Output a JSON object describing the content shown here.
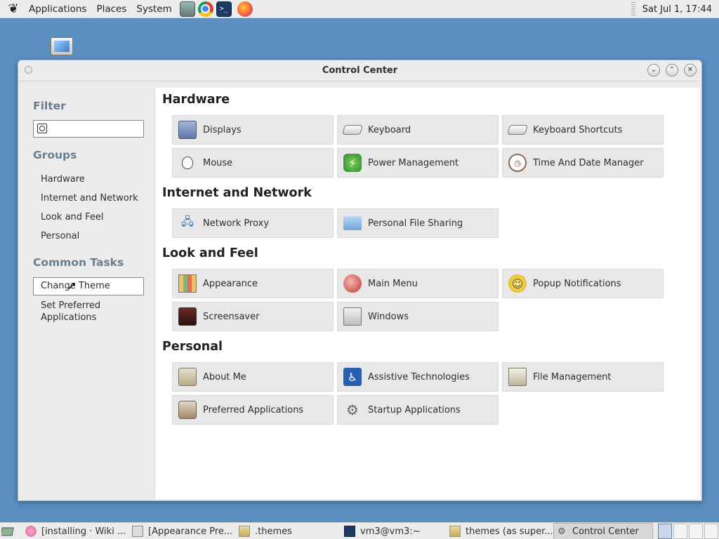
{
  "top_panel": {
    "menus": [
      "Applications",
      "Places",
      "System"
    ],
    "clock": "Sat Jul 1, 17:44"
  },
  "window": {
    "title": "Control Center",
    "buttons": {
      "minimize": "⌄",
      "maximize": "⌃",
      "close": "✕"
    }
  },
  "sidebar": {
    "filter_heading": "Filter",
    "filter_placeholder": "",
    "groups_heading": "Groups",
    "groups": [
      "Hardware",
      "Internet and Network",
      "Look and Feel",
      "Personal"
    ],
    "tasks_heading": "Common Tasks",
    "tasks": [
      "Change Theme",
      "Set Preferred",
      "Applications"
    ]
  },
  "main": {
    "groups": [
      {
        "title": "Hardware",
        "items": [
          "Displays",
          "Keyboard",
          "Keyboard Shortcuts",
          "Mouse",
          "Power Management",
          "Time And Date Manager"
        ]
      },
      {
        "title": "Internet and Network",
        "items": [
          "Network Proxy",
          "Personal File Sharing"
        ]
      },
      {
        "title": "Look and Feel",
        "items": [
          "Appearance",
          "Main Menu",
          "Popup Notifications",
          "Screensaver",
          "Windows"
        ]
      },
      {
        "title": "Personal",
        "items": [
          "About Me",
          "Assistive Technologies",
          "File Management",
          "Preferred Applications",
          "Startup Applications"
        ]
      }
    ]
  },
  "taskbar": {
    "tasks": [
      "[installing · Wiki ...",
      "[Appearance Pre...",
      ".themes",
      "vm3@vm3:~",
      "themes (as super...",
      "Control Center"
    ]
  },
  "colors": {
    "desktop": "#5a8fc0",
    "panel": "#ececec",
    "heading_muted": "#6e7d8c"
  }
}
